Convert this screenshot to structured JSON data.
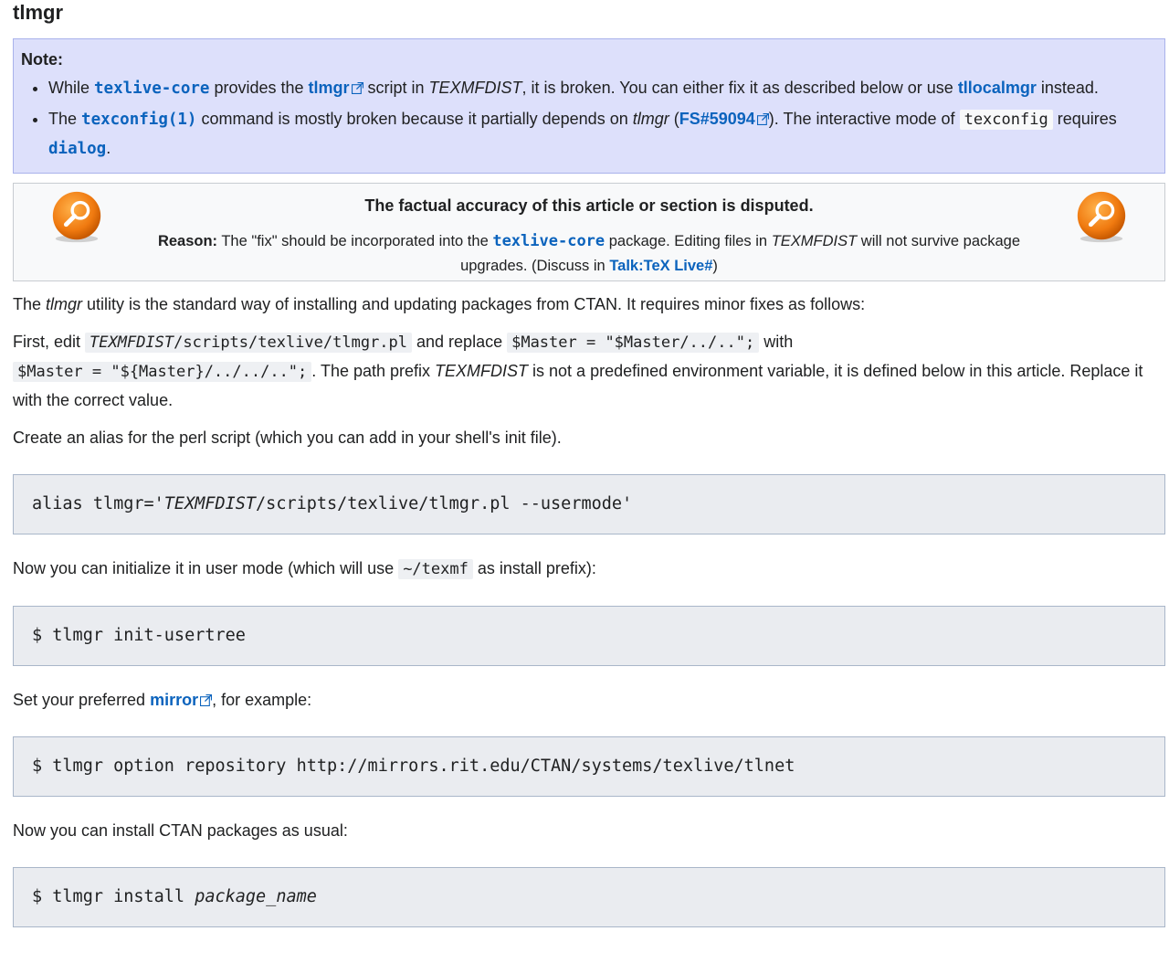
{
  "heading": "tlmgr",
  "note": {
    "title": "Note:",
    "item1": {
      "t1": "While ",
      "link_core": "texlive-core",
      "t2": " provides the ",
      "link_tlmgr": "tlmgr",
      "t3": " script in ",
      "em_dist": "TEXMFDIST",
      "t4": ", it is broken. You can either fix it as described below or use ",
      "link_tllocalmgr": "tllocalmgr",
      "t5": " instead."
    },
    "item2": {
      "t1": "The ",
      "link_texconfig": "texconfig(1)",
      "t2": " command is mostly broken because it partially depends on ",
      "em_tlmgr": "tlmgr",
      "t3": " (",
      "link_fs": "FS#59094",
      "t4": "). The interactive mode of ",
      "code_texconfig": "texconfig",
      "t5": " requires ",
      "link_dialog": "dialog",
      "t6": "."
    }
  },
  "dispute": {
    "title": "The factual accuracy of this article or section is disputed.",
    "reason_label": "Reason:",
    "r1": " The \"fix\" should be incorporated into the ",
    "link_core": "texlive-core",
    "r2": " package. Editing files in ",
    "em_dist": "TEXMFDIST",
    "r3": " will not survive package upgrades. (Discuss in ",
    "link_talk": "Talk:TeX Live#",
    "r4": ")"
  },
  "p1": {
    "t1": "The ",
    "em": "tlmgr",
    "t2": " utility is the standard way of installing and updating packages from CTAN. It requires minor fixes as follows:"
  },
  "p2": {
    "t1": "First, edit ",
    "code_path_em": "TEXMFDIST",
    "code_path": "/scripts/texlive/tlmgr.pl",
    "t2": " and replace ",
    "code_old": "$Master = \"$Master/../..\";",
    "t3": " with",
    "code_new": "$Master = \"${Master}/../../..\";",
    "t4": ". The path prefix ",
    "em_dist": "TEXMFDIST",
    "t5": " is not a predefined environment variable, it is defined below in this article. Replace it with the correct value."
  },
  "p3": "Create an alias for the perl script (which you can add in your shell's init file).",
  "code1": {
    "pre": "alias tlmgr='",
    "em": "TEXMFDIST",
    "post": "/scripts/texlive/tlmgr.pl --usermode'"
  },
  "p4": {
    "t1": "Now you can initialize it in user mode (which will use ",
    "code": "~/texmf",
    "t2": " as install prefix):"
  },
  "code2": "$ tlmgr init-usertree",
  "p5": {
    "t1": "Set your preferred ",
    "link_mirror": "mirror",
    "t2": ", for example:"
  },
  "code3": "$ tlmgr option repository http://mirrors.rit.edu/CTAN/systems/texlive/tlnet",
  "p6": "Now you can install CTAN packages as usual:",
  "code4": {
    "pre": "$ tlmgr install ",
    "em": "package_name"
  },
  "icons": {
    "external": "external-link-icon",
    "magnifier": "magnifier-icon"
  },
  "colors": {
    "link": "#0b63bd",
    "note_bg": "#dde0fb",
    "code_bg": "#eaecf0",
    "magnifier": "#f07a10"
  }
}
